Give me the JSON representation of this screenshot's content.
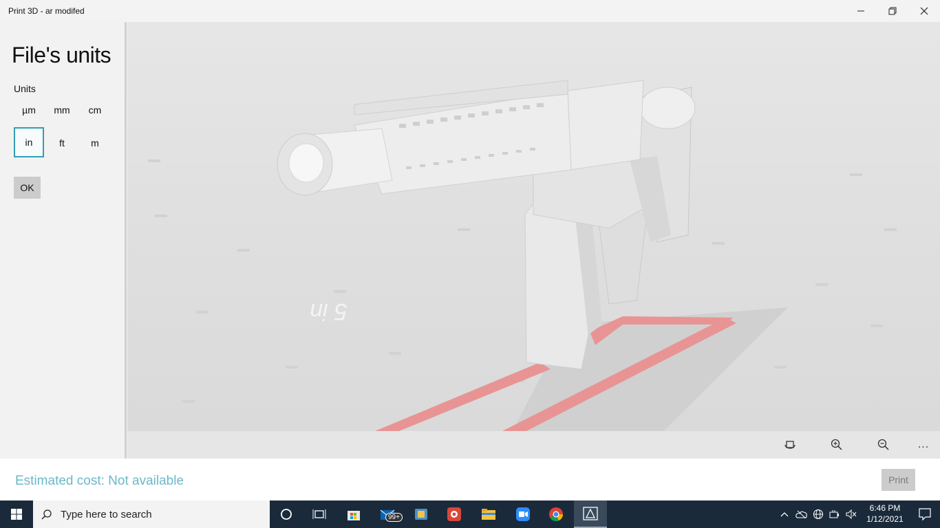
{
  "window": {
    "title": "Print 3D - ar modifed"
  },
  "panel": {
    "heading": "File's units",
    "units_label": "Units",
    "units": [
      "µm",
      "mm",
      "cm",
      "in",
      "ft",
      "m"
    ],
    "selected_unit": "in",
    "ok_label": "OK"
  },
  "viewport": {
    "floor_label": "5 in"
  },
  "toolbar": {
    "icons": [
      "rotate-view-icon",
      "zoom-in-icon",
      "zoom-out-icon",
      "more-icon"
    ],
    "more_label": "..."
  },
  "footer": {
    "cost_text": "Estimated cost: Not available",
    "print_label": "Print"
  },
  "taskbar": {
    "search_placeholder": "Type here to search",
    "mail_badge": "99+",
    "time": "6:46 PM",
    "date": "1/12/2021"
  },
  "colors": {
    "accent": "#2e9fb5",
    "cost_text": "#6ab9c9",
    "taskbar": "#1b2a3a"
  }
}
